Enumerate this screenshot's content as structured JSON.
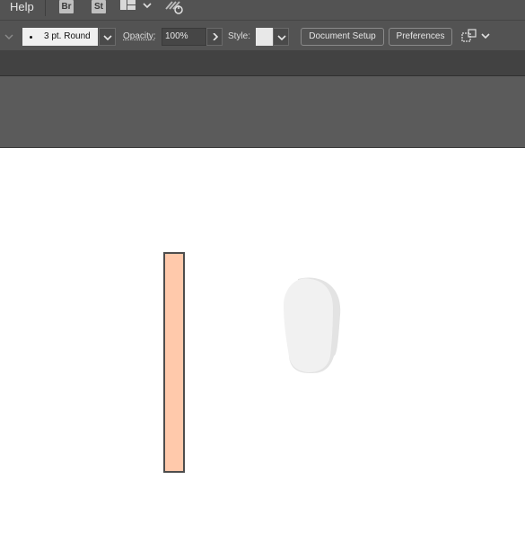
{
  "menubar": {
    "help_label": "Help",
    "bridge_label": "Br",
    "stock_label": "St",
    "workspace_icon": "workspace-layout-icon",
    "sync_icon": "sync-settings-icon"
  },
  "control_bar": {
    "stroke_profile_value": "3 pt. Round",
    "opacity_label": "Opacity:",
    "opacity_value": "100%",
    "style_label": "Style:",
    "document_setup_label": "Document Setup",
    "preferences_label": "Preferences",
    "arrange_icon": "arrange-documents-icon"
  },
  "canvas": {
    "shapes": [
      {
        "kind": "rectangle",
        "fill": "#ffc9ab",
        "stroke": "#4d4d4d"
      },
      {
        "kind": "rounded-blob",
        "fill": "#f1f1f1",
        "shadow": "#e3e3e3"
      }
    ]
  },
  "colors": {
    "ui_dark": "#535353",
    "pasteboard": "#5b5b5b",
    "tab_bar": "#424242",
    "artboard": "#ffffff"
  }
}
